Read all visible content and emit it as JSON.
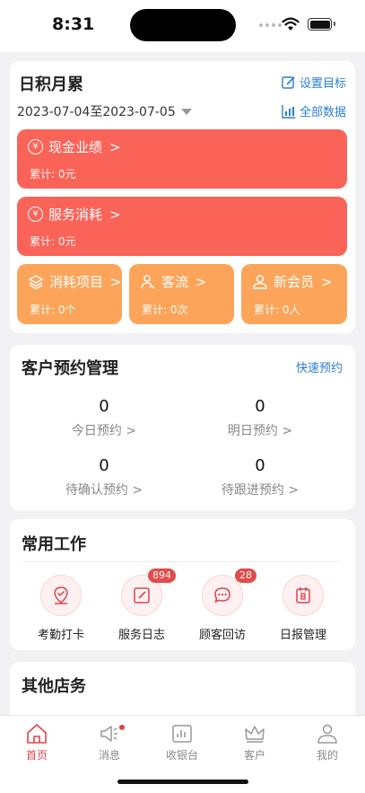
{
  "status": {
    "time": "8:31"
  },
  "summary": {
    "title": "日积月累",
    "set_goal": "设置目标",
    "all_data": "全部数据",
    "date_range": "2023-07-04至2023-07-05",
    "cash": {
      "label": "现金业绩",
      "total": "累计: 0元"
    },
    "service": {
      "label": "服务消耗",
      "total": "累计: 0元"
    },
    "items": {
      "label": "消耗项目",
      "total": "累计: 0个"
    },
    "traffic": {
      "label": "客流",
      "total": "累计: 0次"
    },
    "members": {
      "label": "新会员",
      "total": "累计: 0人"
    }
  },
  "appointments": {
    "title": "客户预约管理",
    "quick": "快速预约",
    "today": {
      "value": "0",
      "label": "今日预约 >"
    },
    "tomorrow": {
      "value": "0",
      "label": "明日预约 >"
    },
    "pending_confirm": {
      "value": "0",
      "label": "待确认预约 >"
    },
    "pending_follow": {
      "value": "0",
      "label": "待跟进预约 >"
    }
  },
  "work": {
    "title": "常用工作",
    "items": [
      {
        "label": "考勤打卡",
        "badge": ""
      },
      {
        "label": "服务日志",
        "badge": "894"
      },
      {
        "label": "顾客回访",
        "badge": "28"
      },
      {
        "label": "日报管理",
        "badge": ""
      }
    ]
  },
  "other": {
    "title": "其他店务"
  },
  "tabs": [
    {
      "label": "首页"
    },
    {
      "label": "消息"
    },
    {
      "label": "收银台"
    },
    {
      "label": "客户"
    },
    {
      "label": "我的"
    }
  ],
  "colors": {
    "red_tile": "#fa6358",
    "orange_tile": "#fca55a",
    "accent": "#e0414a",
    "link": "#2a7fd4"
  }
}
